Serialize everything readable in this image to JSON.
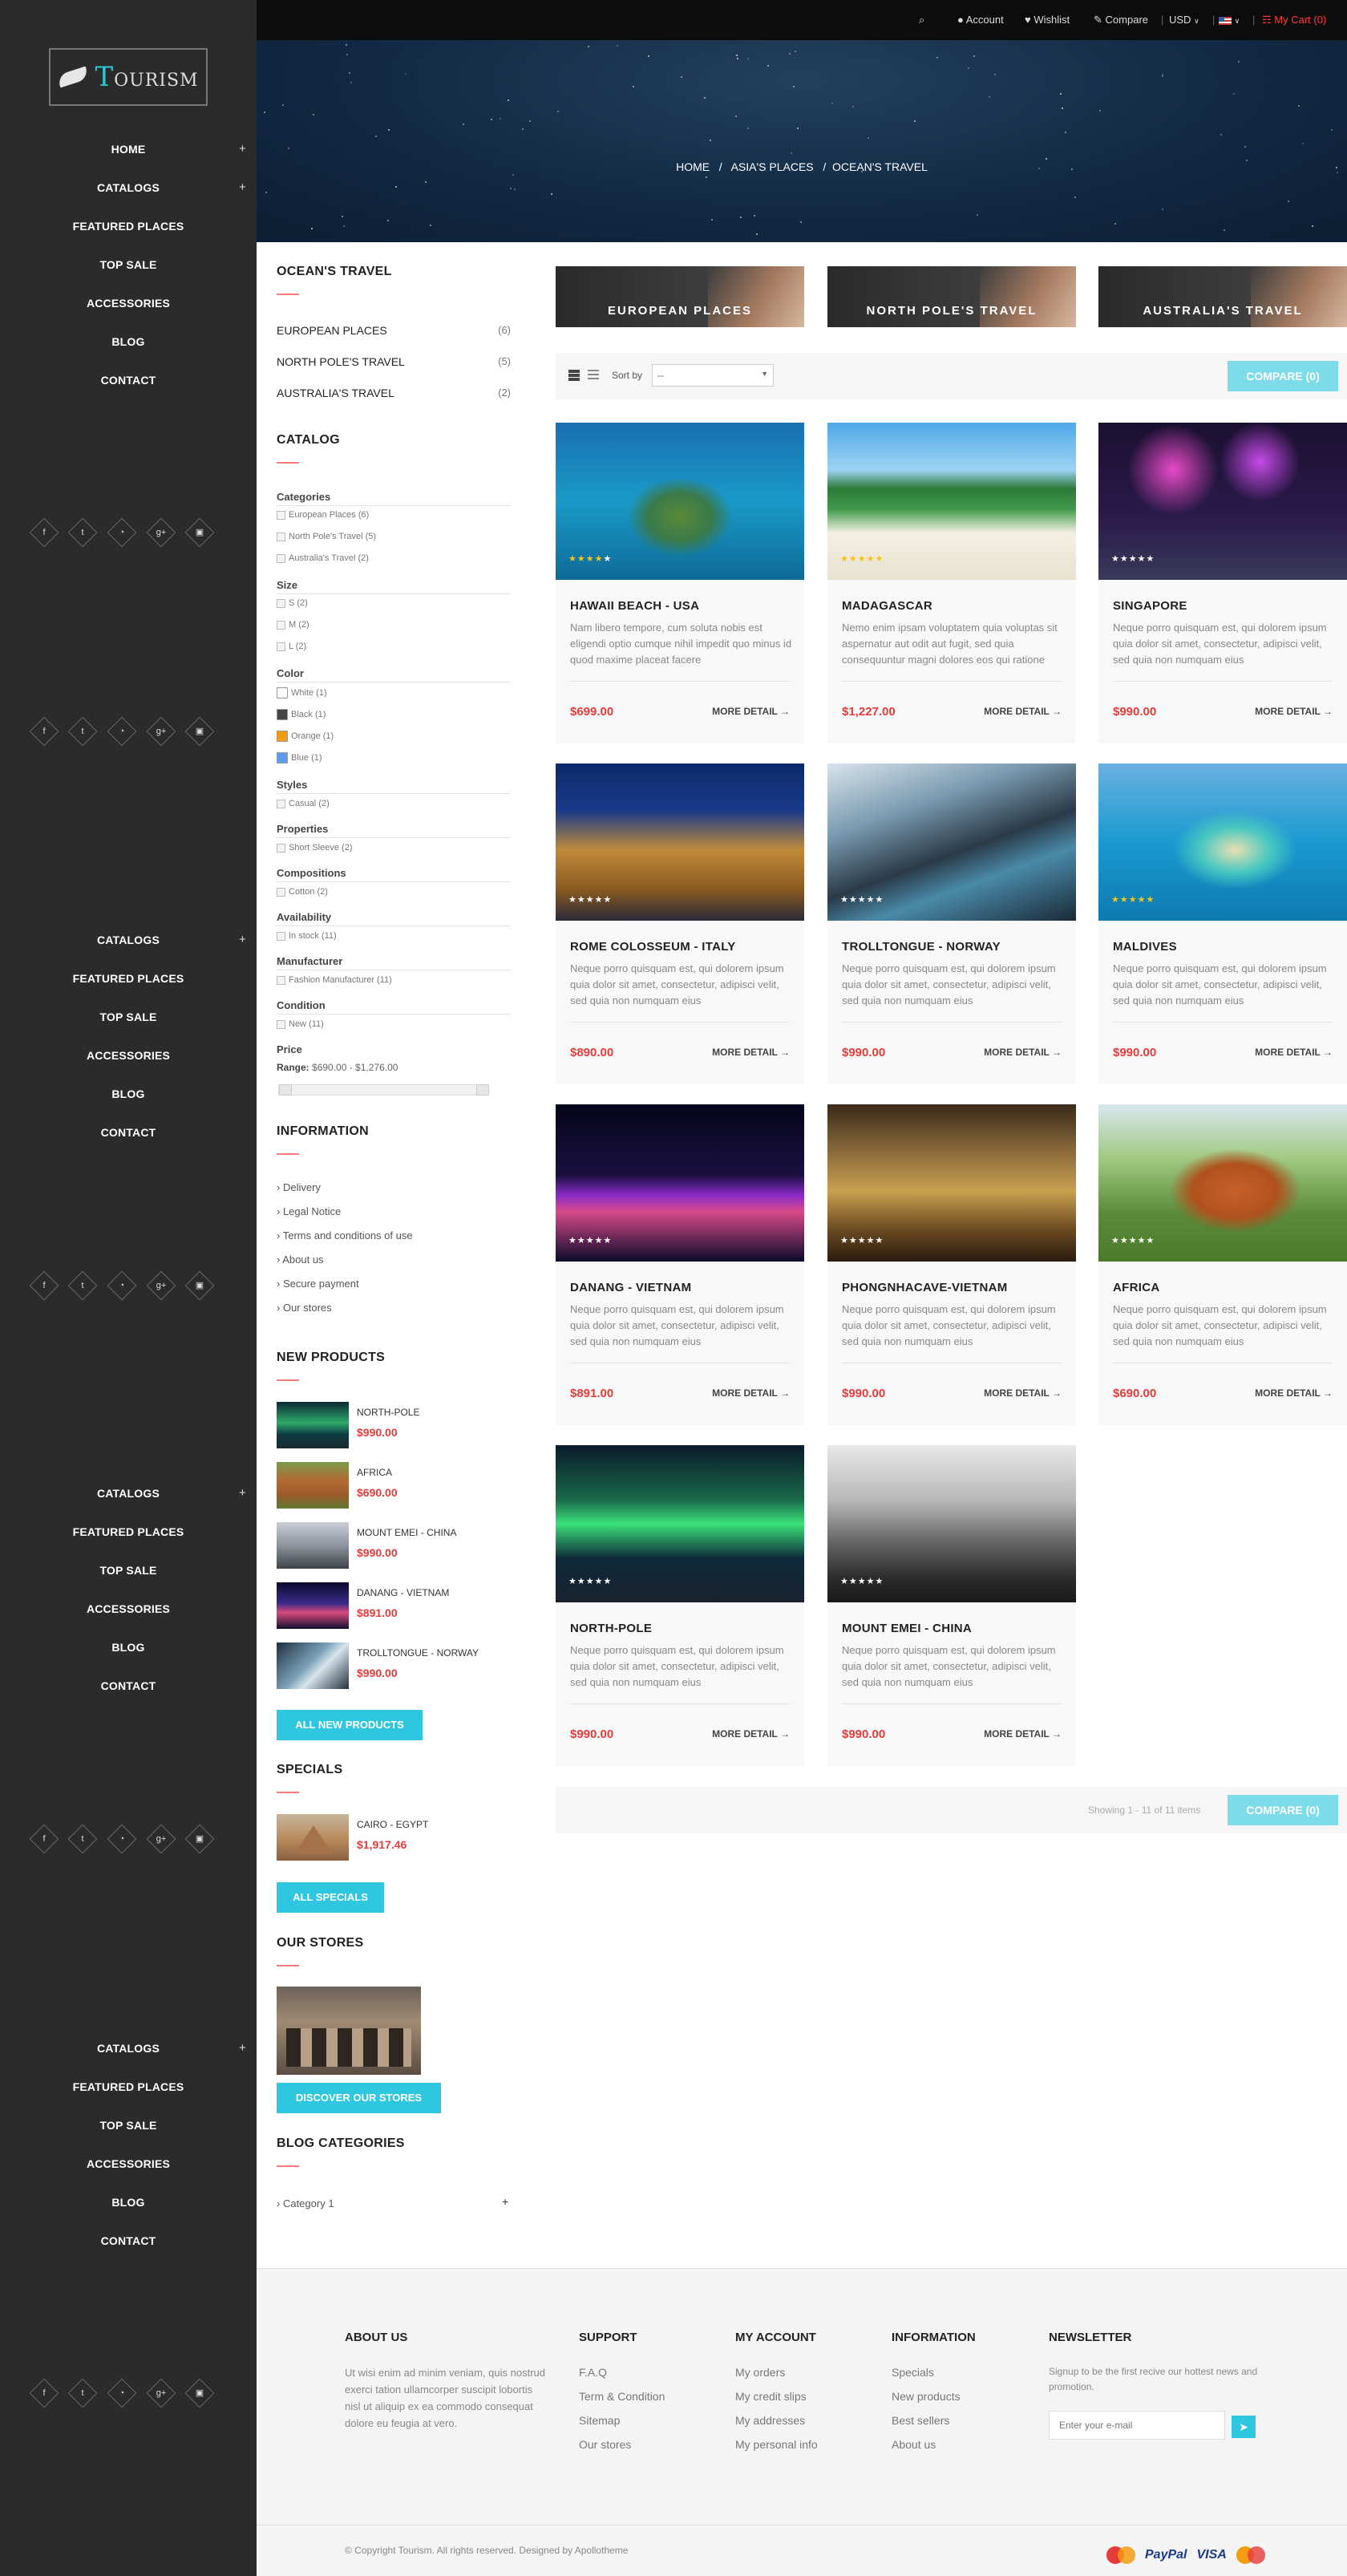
{
  "sidebar": {
    "logo_initial": "T",
    "logo_rest": "OURISM",
    "menu": [
      {
        "label": "HOME",
        "plus": "+"
      },
      {
        "label": "CATALOGS",
        "plus": "+"
      },
      {
        "label": "FEATURED PLACES",
        "plus": ""
      },
      {
        "label": "TOP SALE",
        "plus": ""
      },
      {
        "label": "ACCESSORIES",
        "plus": ""
      },
      {
        "label": "BLOG",
        "plus": ""
      },
      {
        "label": "CONTACT",
        "plus": ""
      }
    ],
    "menu_short": [
      {
        "label": "CATALOGS",
        "plus": "+"
      },
      {
        "label": "FEATURED PLACES",
        "plus": ""
      },
      {
        "label": "TOP SALE",
        "plus": ""
      },
      {
        "label": "ACCESSORIES",
        "plus": ""
      },
      {
        "label": "BLOG",
        "plus": ""
      },
      {
        "label": "CONTACT",
        "plus": ""
      }
    ],
    "social": [
      {
        "icon": "facebook-icon",
        "glyph": "f"
      },
      {
        "icon": "twitter-icon",
        "glyph": "t"
      },
      {
        "icon": "rss-icon",
        "glyph": "◔"
      },
      {
        "icon": "google-plus-icon",
        "glyph": "g+"
      },
      {
        "icon": "instagram-icon",
        "glyph": "▣"
      }
    ]
  },
  "topbar": {
    "account": "Account",
    "wishlist": "Wishlist",
    "compare": "Compare",
    "currency": "USD",
    "cart": "My Cart (0)"
  },
  "breadcrumb": {
    "home": "HOME",
    "sep": "/",
    "level1": "ASIA'S PLACES",
    "level2": "OCEAN'S TRAVEL"
  },
  "left": {
    "category_title": "OCEAN'S TRAVEL",
    "subcategories": [
      {
        "name": "EUROPEAN PLACES",
        "count": "(6)"
      },
      {
        "name": "NORTH POLE'S TRAVEL",
        "count": "(5)"
      },
      {
        "name": "AUSTRALIA'S TRAVEL",
        "count": "(2)"
      }
    ],
    "catalog_title": "CATALOG",
    "filters": {
      "categories": {
        "label": "Categories",
        "items": [
          "European Places (6)",
          "North Pole's Travel (5)",
          "Australia's Travel (2)"
        ]
      },
      "size": {
        "label": "Size",
        "items": [
          "S (2)",
          "M (2)",
          "L (2)"
        ]
      },
      "color": {
        "label": "Color",
        "items": [
          {
            "label": "White (1)",
            "hex": "#ffffff"
          },
          {
            "label": "Black (1)",
            "hex": "#444444"
          },
          {
            "label": "Orange (1)",
            "hex": "#f39c11"
          },
          {
            "label": "Blue (1)",
            "hex": "#5d9cec"
          }
        ]
      },
      "styles": {
        "label": "Styles",
        "items": [
          "Casual (2)"
        ]
      },
      "properties": {
        "label": "Properties",
        "items": [
          "Short Sleeve (2)"
        ]
      },
      "compositions": {
        "label": "Compositions",
        "items": [
          "Cotton (2)"
        ]
      },
      "availability": {
        "label": "Availability",
        "items": [
          "In stock (11)"
        ]
      },
      "manufacturer": {
        "label": "Manufacturer",
        "items": [
          "Fashion Manufacturer (11)"
        ]
      },
      "condition": {
        "label": "Condition",
        "items": [
          "New (11)"
        ]
      },
      "price": {
        "label": "Price",
        "range_label": "Range:",
        "range_value": "$690.00 - $1,276.00",
        "min": 690,
        "max": 1276,
        "selected_low_fraction": 0.0,
        "selected_high_fraction": 1.0
      }
    },
    "information_title": "INFORMATION",
    "information": [
      "Delivery",
      "Legal Notice",
      "Terms and conditions of use",
      "About us",
      "Secure payment",
      "Our stores"
    ],
    "new_products_title": "NEW PRODUCTS",
    "new_products": [
      {
        "name": "NORTH-POLE",
        "price": "$990.00"
      },
      {
        "name": "AFRICA",
        "price": "$690.00"
      },
      {
        "name": "MOUNT EMEI - CHINA",
        "price": "$990.00"
      },
      {
        "name": "DANANG - VIETNAM",
        "price": "$891.00"
      },
      {
        "name": "TROLLTONGUE - NORWAY",
        "price": "$990.00"
      }
    ],
    "all_new_products": "ALL NEW PRODUCTS",
    "specials_title": "SPECIALS",
    "special": {
      "name": "CAIRO - EGYPT",
      "price": "$1,917.46"
    },
    "all_specials": "ALL SPECIALS",
    "stores_title": "OUR STORES",
    "discover_stores": "DISCOVER OUR STORES",
    "blog_title": "BLOG CATEGORIES",
    "blog_item": "Category 1",
    "blog_plus": "+"
  },
  "category_boxes": [
    "EUROPEAN PLACES",
    "NORTH POLE'S TRAVEL",
    "AUSTRALIA'S TRAVEL"
  ],
  "toolbar": {
    "sort_label": "Sort by",
    "sort_value": "--",
    "compare": "COMPARE (0)"
  },
  "products": [
    {
      "title": "HAWAII BEACH - USA",
      "desc": "Nam libero tempore, cum soluta nobis est eligendi optio cumque nihil impedit quo minus id quod maxime placeat facere",
      "price": "$699.00",
      "rating": 4,
      "more": "MORE DETAIL →"
    },
    {
      "title": "MADAGASCAR",
      "desc": "Nemo enim ipsam voluptatem quia voluptas sit aspernatur aut odit aut fugit, sed quia consequuntur magni dolores eos qui ratione",
      "price": "$1,227.00",
      "rating": 5,
      "more": "MORE DETAIL →"
    },
    {
      "title": "SINGAPORE",
      "desc": "Neque porro quisquam est, qui dolorem ipsum quia dolor sit amet, consectetur, adipisci velit, sed quia non numquam eius",
      "price": "$990.00",
      "rating": 0,
      "more": "MORE DETAIL →"
    },
    {
      "title": "ROME COLOSSEUM - ITALY",
      "desc": "Neque porro quisquam est, qui dolorem ipsum quia dolor sit amet, consectetur, adipisci velit, sed quia non numquam eius",
      "price": "$890.00",
      "rating": 0,
      "more": "MORE DETAIL →"
    },
    {
      "title": "TROLLTONGUE - NORWAY",
      "desc": "Neque porro quisquam est, qui dolorem ipsum quia dolor sit amet, consectetur, adipisci velit, sed quia non numquam eius",
      "price": "$990.00",
      "rating": 0,
      "more": "MORE DETAIL →"
    },
    {
      "title": "MALDIVES",
      "desc": "Neque porro quisquam est, qui dolorem ipsum quia dolor sit amet, consectetur, adipisci velit, sed quia non numquam eius",
      "price": "$990.00",
      "rating": 5,
      "more": "MORE DETAIL →"
    },
    {
      "title": "DANANG - VIETNAM",
      "desc": "Neque porro quisquam est, qui dolorem ipsum quia dolor sit amet, consectetur, adipisci velit, sed quia non numquam eius",
      "price": "$891.00",
      "rating": 0,
      "more": "MORE DETAIL →"
    },
    {
      "title": "PHONGNHACAVE-VIETNAM",
      "desc": "Neque porro quisquam est, qui dolorem ipsum quia dolor sit amet, consectetur, adipisci velit, sed quia non numquam eius",
      "price": "$990.00",
      "rating": 0,
      "more": "MORE DETAIL →"
    },
    {
      "title": "AFRICA",
      "desc": "Neque porro quisquam est, qui dolorem ipsum quia dolor sit amet, consectetur, adipisci velit, sed quia non numquam eius",
      "price": "$690.00",
      "rating": 0,
      "more": "MORE DETAIL →"
    },
    {
      "title": "NORTH-POLE",
      "desc": "Neque porro quisquam est, qui dolorem ipsum quia dolor sit amet, consectetur, adipisci velit, sed quia non numquam eius",
      "price": "$990.00",
      "rating": 0,
      "more": "MORE DETAIL →"
    },
    {
      "title": "MOUNT EMEI - CHINA",
      "desc": "Neque porro quisquam est, qui dolorem ipsum quia dolor sit amet, consectetur, adipisci velit, sed quia non numquam eius",
      "price": "$990.00",
      "rating": 0,
      "more": "MORE DETAIL →"
    }
  ],
  "pager": {
    "showing": "Showing 1 - 11 of 11 items",
    "compare": "COMPARE (0)"
  },
  "footer": {
    "about_title": "ABOUT US",
    "about_text": "Ut wisi enim ad minim veniam, quis nostrud exerci tation ullamcorper suscipit lobortis nisl ut aliquip ex ea commodo consequat dolore eu feugia at vero.",
    "support_title": "SUPPORT",
    "support": [
      "F.A.Q",
      "Term & Condition",
      "Sitemap",
      "Our stores"
    ],
    "account_title": "MY ACCOUNT",
    "account": [
      "My orders",
      "My credit slips",
      "My addresses",
      "My personal info"
    ],
    "info_title": "INFORMATION",
    "info": [
      "Specials",
      "New products",
      "Best sellers",
      "About us"
    ],
    "newsletter_title": "NEWSLETTER",
    "newsletter_text": "Signup to be the first recive our hottest news and promotion.",
    "newsletter_placeholder": "Enter your e-mail",
    "copyright": "© Copyright Tourism. All rights reserved. Designed by Apollotheme",
    "payments": [
      "PayPal",
      "VISA"
    ]
  },
  "colors": {
    "accent": "#2fc7e0",
    "price": "#e53b3b",
    "sidebar": "#2b2b2b",
    "star": "#f5c518"
  }
}
